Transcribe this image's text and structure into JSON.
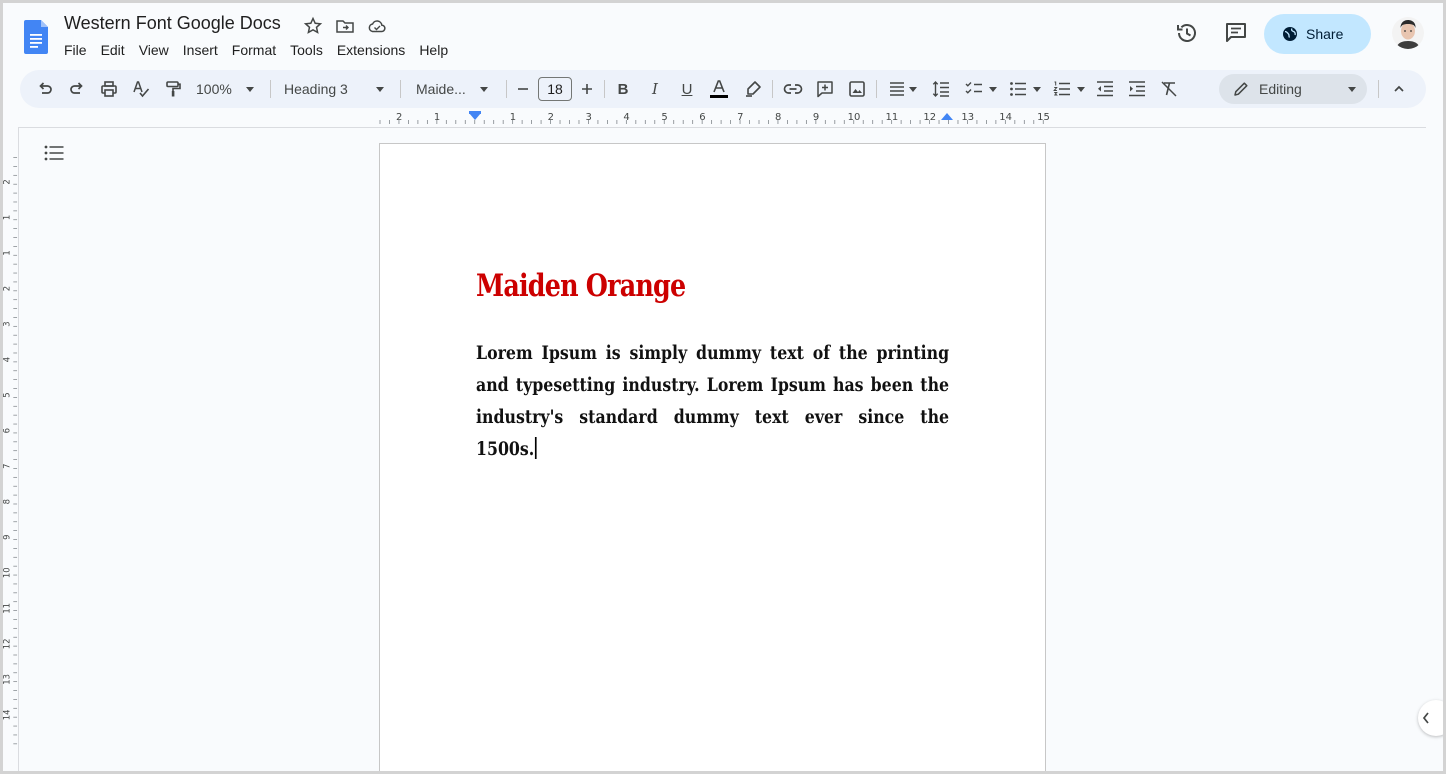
{
  "document": {
    "title": "Western Font Google Docs",
    "heading": "Maiden Orange",
    "body": "Lorem Ipsum is simply dummy text of the printing and typesetting industry. Lorem Ipsum has been the industry's standard dummy text ever since the 1500s.",
    "heading_color": "#cc0000"
  },
  "menu": [
    "File",
    "Edit",
    "View",
    "Insert",
    "Format",
    "Tools",
    "Extensions",
    "Help"
  ],
  "header": {
    "share_label": "Share",
    "share_color": "#c2e7ff"
  },
  "toolbar": {
    "zoom": "100%",
    "style": "Heading 3",
    "font": "Maide...",
    "font_size": "18",
    "mode": "Editing"
  },
  "ruler": {
    "h_labels": [
      "2",
      "1",
      "1",
      "2",
      "3",
      "4",
      "5",
      "6",
      "7",
      "8",
      "9",
      "10",
      "11",
      "12",
      "13",
      "14",
      "15"
    ],
    "v_labels": [
      "2",
      "1",
      "1",
      "2",
      "3",
      "4",
      "5",
      "6",
      "7",
      "8",
      "9",
      "10",
      "11",
      "12",
      "13",
      "14"
    ]
  },
  "icons": {
    "logo": "docs-logo-icon",
    "history": "history-icon",
    "comments": "comment-icon",
    "share": "globe-icon"
  }
}
